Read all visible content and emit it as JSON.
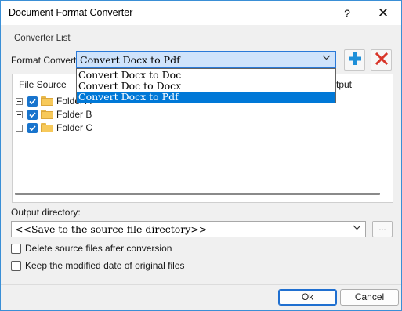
{
  "window": {
    "title": "Document Format Converter",
    "help_glyph": "?",
    "close_glyph": "✕"
  },
  "group": {
    "label": "Converter List"
  },
  "format": {
    "label": "Format Convert",
    "selected": "Convert Docx to Pdf",
    "options": [
      "Convert Docx to Doc",
      "Convert Doc to Docx",
      "Convert Docx to Pdf"
    ],
    "add_icon": "plus-icon",
    "delete_icon": "x-icon"
  },
  "tree": {
    "header_left": "File Source",
    "header_right": "tput",
    "items": [
      {
        "label": "Folder A",
        "checked": true
      },
      {
        "label": "Folder B",
        "checked": true
      },
      {
        "label": "Folder C",
        "checked": true
      }
    ]
  },
  "output": {
    "label": "Output directory:",
    "value": "<<Save to the source file directory>>",
    "browse_label": "..."
  },
  "options": {
    "delete_source": "Delete source files after conversion",
    "keep_date": "Keep the modified date of original files"
  },
  "buttons": {
    "ok": "Ok",
    "cancel": "Cancel"
  },
  "colors": {
    "accent": "#0078d7",
    "select_bg": "#cfe3fb",
    "add_icon": "#1e8fd8",
    "delete_icon": "#d8362a"
  }
}
